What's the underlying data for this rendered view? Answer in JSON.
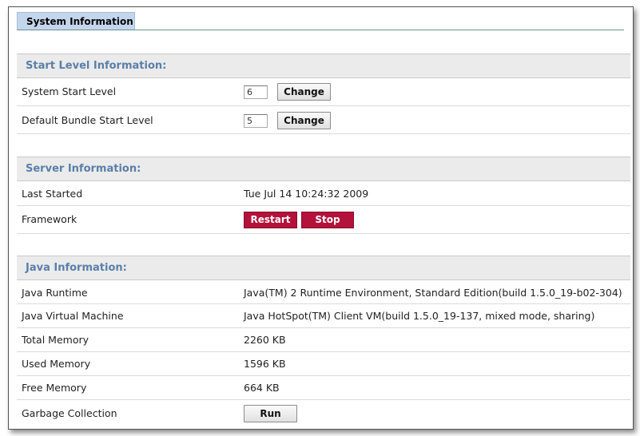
{
  "tab": {
    "label": "System Information"
  },
  "start_level": {
    "header": "Start Level Information:",
    "rows": [
      {
        "label": "System Start Level",
        "value": "6",
        "button": "Change"
      },
      {
        "label": "Default Bundle Start Level",
        "value": "5",
        "button": "Change"
      }
    ]
  },
  "server": {
    "header": "Server Information:",
    "last_started_label": "Last Started",
    "last_started_value": "Tue Jul 14 10:24:32 2009",
    "framework_label": "Framework",
    "restart_button": "Restart",
    "stop_button": "Stop"
  },
  "java": {
    "header": "Java Information:",
    "rows": [
      {
        "label": "Java Runtime",
        "value": "Java(TM) 2 Runtime Environment, Standard Edition(build 1.5.0_19-b02-304)"
      },
      {
        "label": "Java Virtual Machine",
        "value": "Java HotSpot(TM) Client VM(build 1.5.0_19-137, mixed mode, sharing)"
      },
      {
        "label": "Total Memory",
        "value": "2260 KB"
      },
      {
        "label": "Used Memory",
        "value": "1596 KB"
      },
      {
        "label": "Free Memory",
        "value": "664 KB"
      }
    ],
    "gc_label": "Garbage Collection",
    "gc_button": "Run"
  },
  "colors": {
    "section_header_text": "#5a7fa9",
    "danger_button": "#b3123a",
    "tab_background": "#c4d6ec"
  }
}
